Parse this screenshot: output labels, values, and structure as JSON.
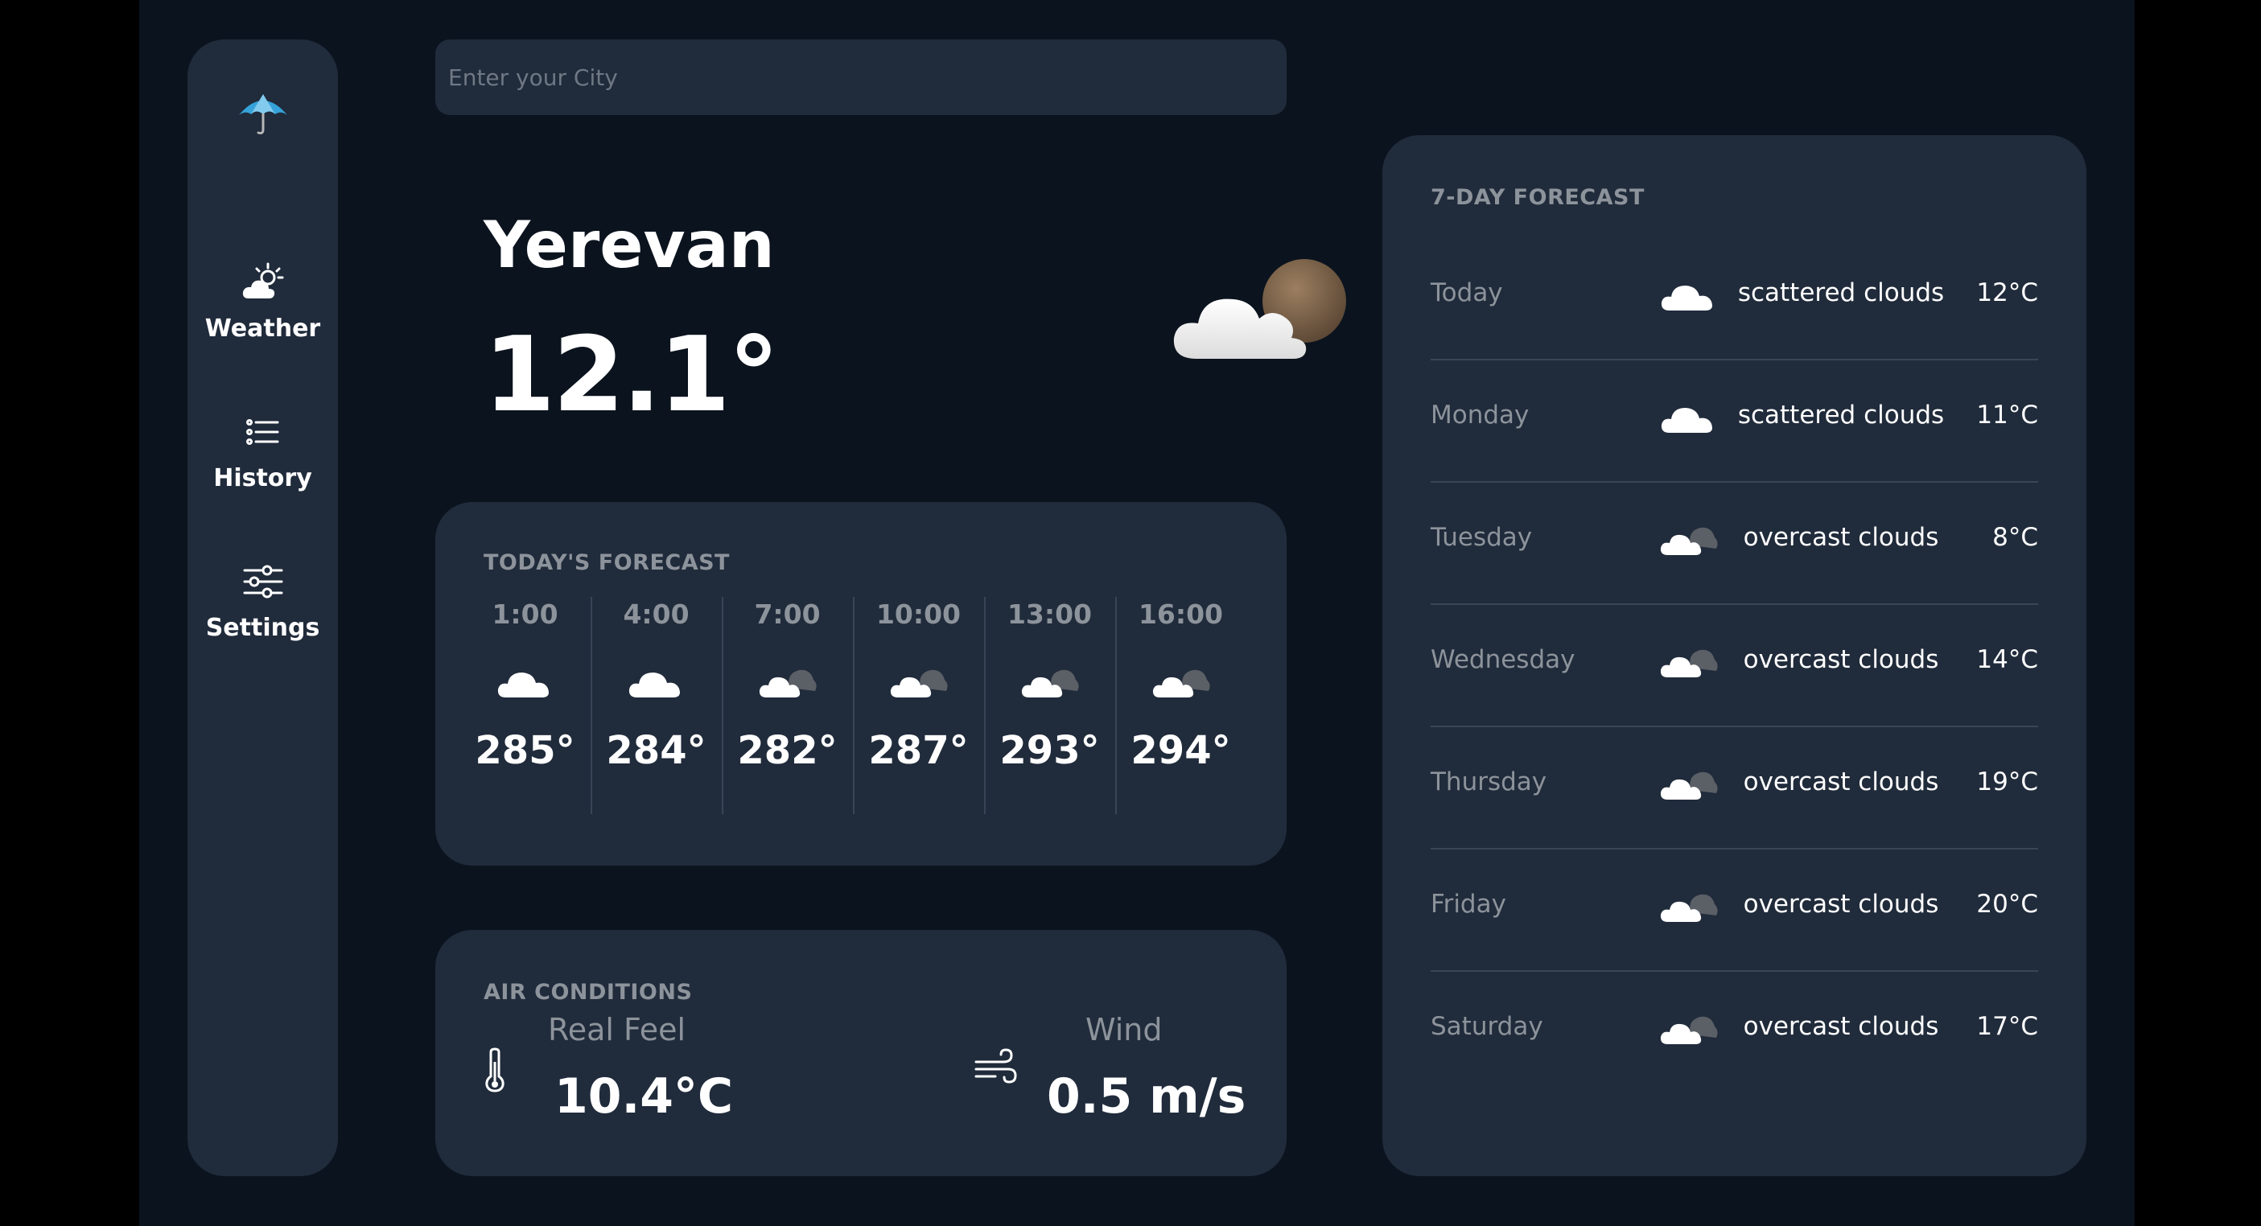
{
  "sidebar": {
    "logo_icon": "umbrella-icon",
    "items": [
      {
        "label": "Weather",
        "icon": "weather-icon"
      },
      {
        "label": "History",
        "icon": "list-icon"
      },
      {
        "label": "Settings",
        "icon": "sliders-icon"
      }
    ]
  },
  "search": {
    "placeholder": "Enter your City",
    "value": ""
  },
  "current": {
    "city": "Yerevan",
    "temperature": "12.1°",
    "icon": "cloud-moon-icon"
  },
  "today_forecast": {
    "title": "TODAY'S FORECAST",
    "hours": [
      {
        "time": "1:00",
        "temp": "285°",
        "icon": "cloud-icon"
      },
      {
        "time": "4:00",
        "temp": "284°",
        "icon": "cloud-icon"
      },
      {
        "time": "7:00",
        "temp": "282°",
        "icon": "overcast-icon"
      },
      {
        "time": "10:00",
        "temp": "287°",
        "icon": "overcast-icon"
      },
      {
        "time": "13:00",
        "temp": "293°",
        "icon": "overcast-icon"
      },
      {
        "time": "16:00",
        "temp": "294°",
        "icon": "overcast-icon"
      }
    ]
  },
  "air_conditions": {
    "title": "AIR CONDITIONS",
    "real_feel": {
      "label": "Real Feel",
      "value": "10.4°C",
      "icon": "thermometer-icon"
    },
    "wind": {
      "label": "Wind",
      "value": "0.5 m/s",
      "icon": "wind-icon"
    }
  },
  "week_forecast": {
    "title": "7-DAY FORECAST",
    "days": [
      {
        "day": "Today",
        "desc": "scattered clouds",
        "temp": "12°C",
        "icon": "cloud-icon"
      },
      {
        "day": "Monday",
        "desc": "scattered clouds",
        "temp": "11°C",
        "icon": "cloud-icon"
      },
      {
        "day": "Tuesday",
        "desc": "overcast clouds",
        "temp": "8°C",
        "icon": "overcast-icon"
      },
      {
        "day": "Wednesday",
        "desc": "overcast clouds",
        "temp": "14°C",
        "icon": "overcast-icon"
      },
      {
        "day": "Thursday",
        "desc": "overcast clouds",
        "temp": "19°C",
        "icon": "overcast-icon"
      },
      {
        "day": "Friday",
        "desc": "overcast clouds",
        "temp": "20°C",
        "icon": "overcast-icon"
      },
      {
        "day": "Saturday",
        "desc": "overcast clouds",
        "temp": "17°C",
        "icon": "overcast-icon"
      }
    ]
  },
  "colors": {
    "page_bg": "#0b131e",
    "panel_bg": "#202b3b",
    "muted_text": "#8d939b",
    "text": "#ffffff"
  }
}
